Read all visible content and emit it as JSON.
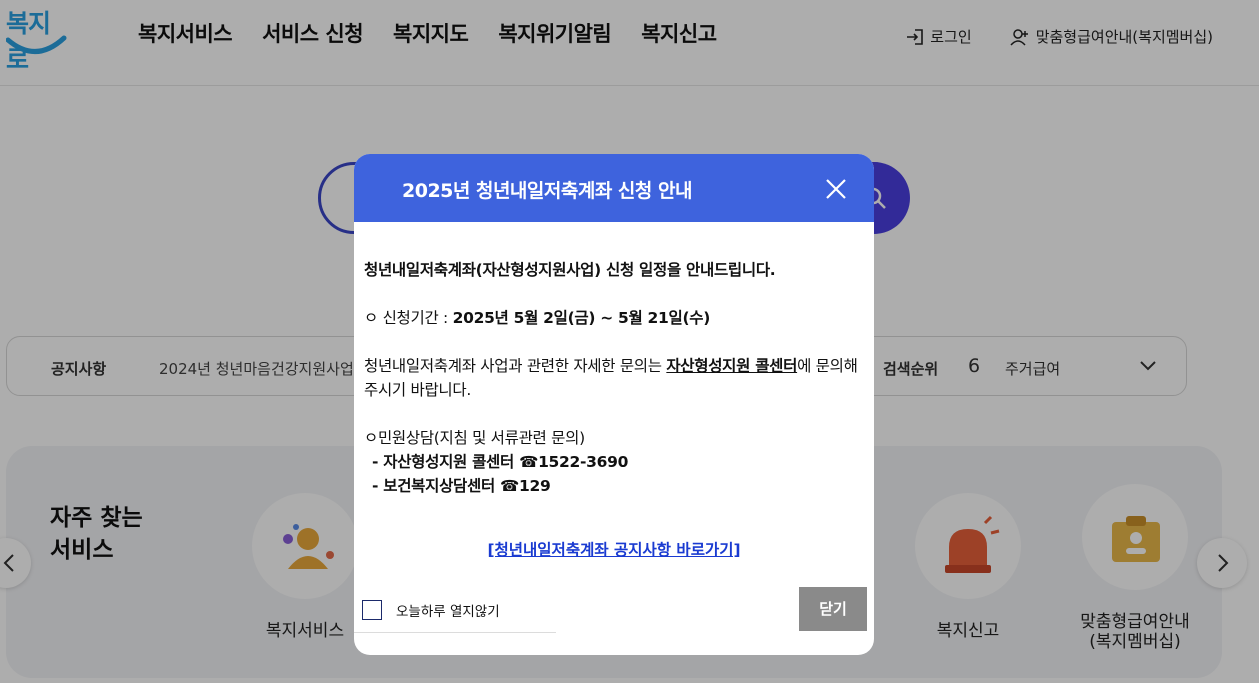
{
  "header": {
    "logo_text": "복지로",
    "nav": [
      "복지서비스",
      "서비스 신청",
      "복지지도",
      "복지위기알림",
      "복지신고"
    ],
    "login_label": "로그인",
    "membership_label": "맞춤형급여안내(복지멤버십)"
  },
  "notice_bar": {
    "label": "공지사항",
    "text": "2024년 청년마음건강지원사업 안내",
    "rank_label": "검색순위",
    "rank_number": "6",
    "rank_text": "주거급여"
  },
  "faq": {
    "title_line1": "자주 찾는",
    "title_line2": "서비스",
    "items": [
      {
        "label": "복지서비스"
      },
      {
        "label": "복지신고"
      },
      {
        "label": "맞춤형급여안내\n(복지멤버십)"
      }
    ]
  },
  "modal": {
    "title": "2025년 청년내일저축계좌 신청 안내",
    "intro": "청년내일저축계좌(자산형성지원사업) 신청 일정을 안내드립니다.",
    "period_prefix": "ㅇ 신청기간 : ",
    "period_value": "2025년 5월 2일(금) ~ 5월 21일(수)",
    "inquiry_prefix": "청년내일저축계좌 사업과 관련한 자세한 문의는 ",
    "inquiry_center": "자산형성지원 콜센터",
    "inquiry_suffix": "에 문의해주시기 바랍니다.",
    "civil_title": "ㅇ민원상담(지침 및 서류관련 문의)",
    "contact1": "- 자산형성지원 콜센터 ☎1522-3690",
    "contact2": "- 보건복지상담센터 ☎129",
    "link_text": "[청년내일저축계좌 공지사항 바로가기]",
    "dont_show_label": "오늘하루 열지않기",
    "close_label": "닫기"
  },
  "colors": {
    "modal_header": "#3e63dd",
    "close_button": "#8a8a8a",
    "link": "#1a3bd1",
    "search_border": "#3a46c8"
  }
}
